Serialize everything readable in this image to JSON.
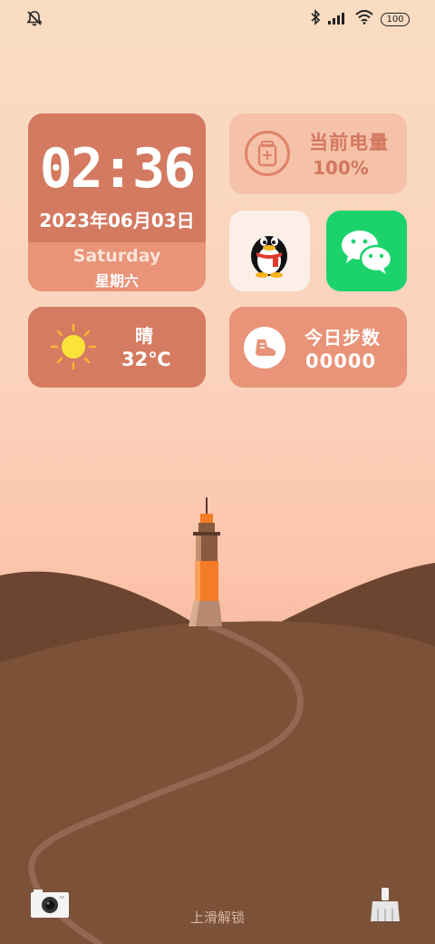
{
  "status_bar": {
    "left_icon": "mute-icon",
    "right_icons": [
      "bluetooth-icon",
      "signal-icon",
      "wifi-icon"
    ],
    "battery": "100"
  },
  "clock_widget": {
    "time": "02:36",
    "date": "2023年06月03日",
    "weekday_en": "Saturday",
    "weekday_cn": "星期六"
  },
  "battery_widget": {
    "title": "当前电量",
    "value": "100%",
    "icon": "battery-icon"
  },
  "apps": [
    {
      "name": "QQ",
      "icon": "qq-penguin-icon"
    },
    {
      "name": "WeChat",
      "icon": "wechat-icon"
    }
  ],
  "weather_widget": {
    "condition": "晴",
    "temperature": "32℃",
    "icon": "sun-icon"
  },
  "steps_widget": {
    "title": "今日步数",
    "value": "00000",
    "icon": "shoe-icon"
  },
  "lock_screen": {
    "unlock_hint": "上滑解锁",
    "left_shortcut": "camera-icon",
    "right_shortcut": "broom-icon"
  },
  "colors": {
    "card_dark": "#d47a61",
    "card_light": "#e99378",
    "battery_card": "#f5c1a9",
    "wechat_green": "#1cd36b",
    "hill_dark": "#6b4530",
    "hill_main": "#7b5138",
    "lighthouse_orange": "#f47c24"
  }
}
